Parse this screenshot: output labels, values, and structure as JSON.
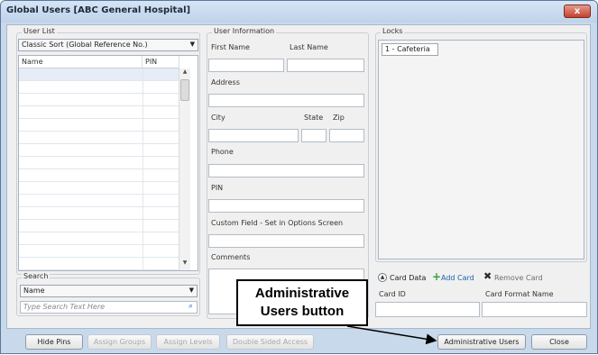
{
  "window": {
    "title": "Global Users [ABC General Hospital]",
    "close_glyph": "x"
  },
  "user_list": {
    "legend": "User List",
    "sort_selected": "Classic Sort (Global Reference No.)",
    "columns": [
      "Name",
      "PIN"
    ],
    "row_count": 16
  },
  "search": {
    "legend": "Search",
    "field_selected": "Name",
    "placeholder": "Type Search Text Here",
    "icon": "search-icon"
  },
  "user_info": {
    "legend": "User Information",
    "first_name_label": "First Name",
    "last_name_label": "Last Name",
    "address_label": "Address",
    "city_label": "City",
    "state_label": "State",
    "zip_label": "Zip",
    "phone_label": "Phone",
    "pin_label": "PIN",
    "custom_field_label": "Custom Field - Set in Options Screen",
    "comments_label": "Comments"
  },
  "locks": {
    "legend": "Locks",
    "items": [
      "1 - Cafeteria"
    ]
  },
  "card_data": {
    "toggle_label": "Card Data",
    "add_label": "Add Card",
    "remove_label": "Remove Card",
    "card_id_label": "Card ID",
    "card_format_label": "Card Format Name"
  },
  "buttons": {
    "hide_pins": "Hide Pins",
    "assign_groups": "Assign Groups",
    "assign_levels": "Assign Levels",
    "double_sided": "Double Sided Access",
    "admin_users": "Administrative Users",
    "close": "Close"
  },
  "callout": {
    "line1": "Administrative",
    "line2": "Users button"
  },
  "colors": {
    "add_icon": "#3aa33a",
    "remove_icon": "#2b2b2b",
    "link_text": "#1d5fae"
  }
}
